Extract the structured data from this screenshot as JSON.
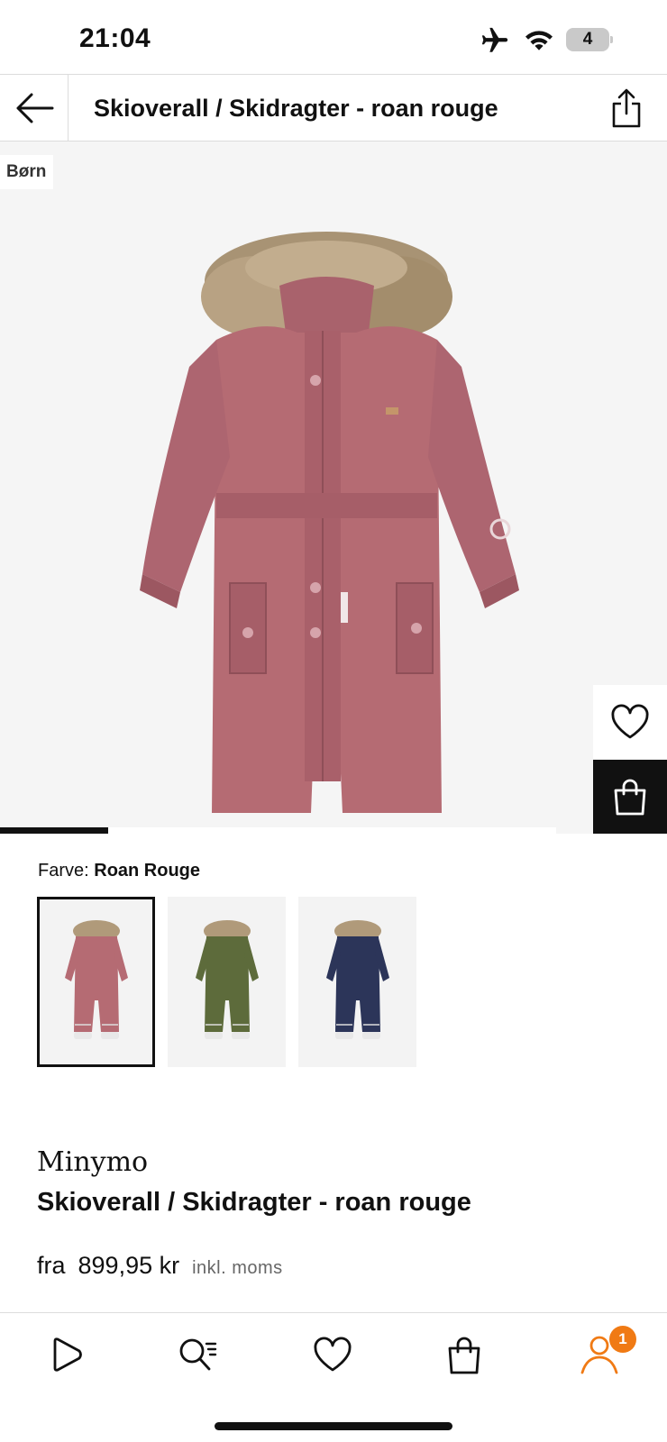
{
  "status_bar": {
    "time": "21:04",
    "battery": "4",
    "icons": [
      "airplane-icon",
      "wifi-icon",
      "battery-icon"
    ]
  },
  "header": {
    "title": "Skioverall / Skidragter - roan rouge",
    "back_icon": "arrow-left-icon",
    "share_icon": "share-icon"
  },
  "gallery": {
    "badge": "Børn",
    "progress": 0.195,
    "wishlist_icon": "heart-icon",
    "bag_icon": "bag-icon"
  },
  "color": {
    "label": "Farve:",
    "selected": "Roan Rouge",
    "swatches": [
      {
        "name": "roan rouge",
        "hex": "#b56b73",
        "selected": true
      },
      {
        "name": "green",
        "hex": "#5d6b3b",
        "selected": false
      },
      {
        "name": "navy",
        "hex": "#2c3559",
        "selected": false
      }
    ]
  },
  "product": {
    "brand": "Minymo",
    "name": "Skioverall / Skidragter - roan rouge",
    "price_prefix": "fra",
    "price": "899,95 kr",
    "vat_note": "inkl. moms"
  },
  "nav": {
    "items": [
      "play-icon",
      "search-icon",
      "heart-icon",
      "bag-icon",
      "profile-icon"
    ],
    "profile_badge": "1",
    "accent": "#f07a14"
  }
}
